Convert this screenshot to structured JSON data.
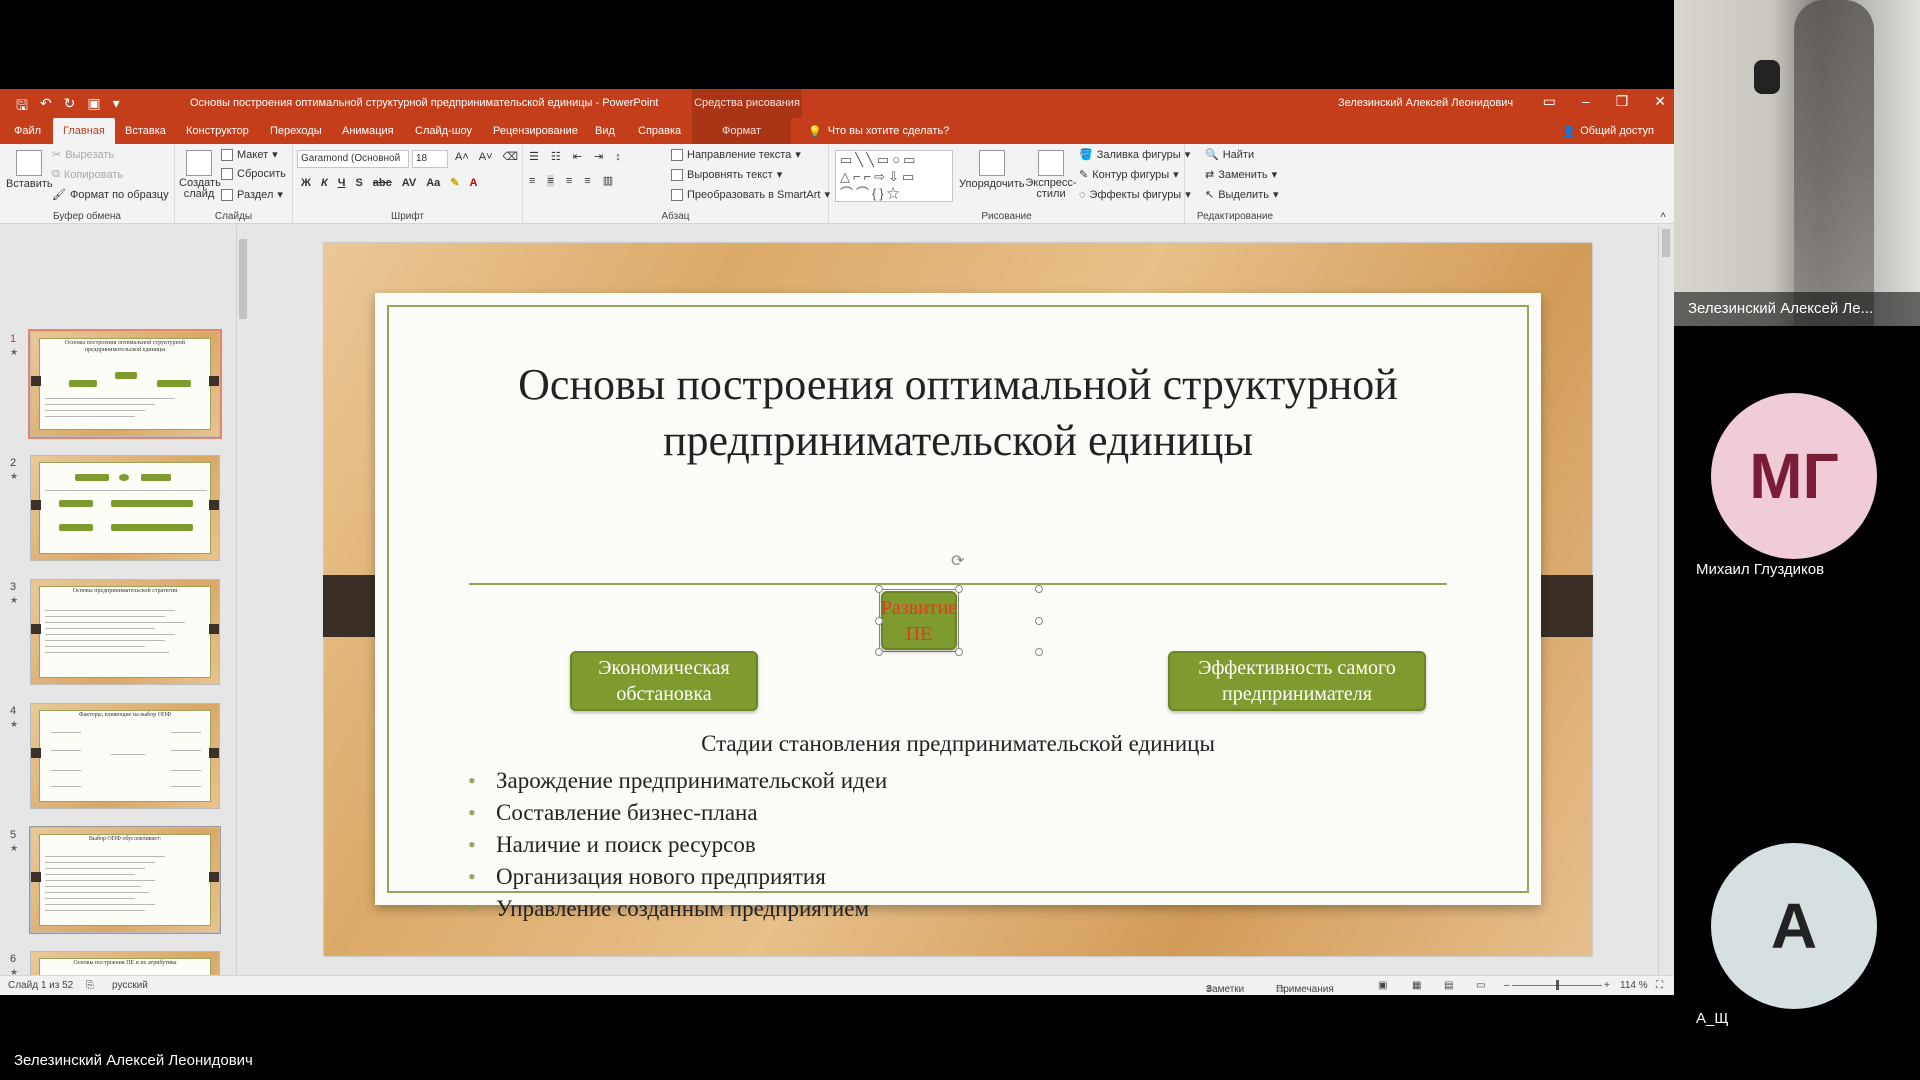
{
  "titlebar": {
    "doc_title": "Основы построения оптимальной структурной предпринимательской единицы  -  PowerPoint",
    "context_tools": "Средства рисования",
    "user": "Зелезинский Алексей Леонидович"
  },
  "tabs": [
    "Файл",
    "Главная",
    "Вставка",
    "Конструктор",
    "Переходы",
    "Анимация",
    "Слайд-шоу",
    "Рецензирование",
    "Вид",
    "Справка"
  ],
  "context_tab": "Формат",
  "tell_me": "Что вы хотите сделать?",
  "share": "Общий доступ",
  "ribbon": {
    "clipboard": {
      "label": "Буфер обмена",
      "paste": "Вставить",
      "cut": "Вырезать",
      "copy": "Копировать",
      "format_painter": "Формат по образцу"
    },
    "slides": {
      "label": "Слайды",
      "new_slide": "Создать слайд",
      "layout": "Макет",
      "reset": "Сбросить",
      "section": "Раздел"
    },
    "font": {
      "label": "Шрифт",
      "font_name": "Garamond (Основной",
      "font_size": "18"
    },
    "paragraph": {
      "label": "Абзац",
      "text_direction": "Направление текста",
      "align_text": "Выровнять текст",
      "smartart": "Преобразовать в SmartArt"
    },
    "drawing": {
      "label": "Рисование",
      "arrange": "Упорядочить",
      "quick_styles": "Экспресс-стили",
      "shape_fill": "Заливка фигуры",
      "shape_outline": "Контур фигуры",
      "shape_effects": "Эффекты фигуры"
    },
    "editing": {
      "label": "Редактирование",
      "find": "Найти",
      "replace": "Заменить",
      "select": "Выделить"
    }
  },
  "thumbnails": [
    {
      "num": "1",
      "title": "Основы построения оптимальной структурной предпринимательской единицы"
    },
    {
      "num": "2",
      "title": ""
    },
    {
      "num": "3",
      "title": "Основы предпринимательской стратегии"
    },
    {
      "num": "4",
      "title": "Факторы, влияющие на выбор ОПФ"
    },
    {
      "num": "5",
      "title": "Выбор ОПФ обусловливает:"
    },
    {
      "num": "6",
      "title": "Основы построения ПЕ и их атрибутика"
    }
  ],
  "slide": {
    "title_line1": "Основы построения оптимальной структурной",
    "title_line2": "предпринимательской единицы",
    "center_box": "Развитие ПЕ",
    "left_box": "Экономическая обстановка",
    "right_box": "Эффективность самого предпринимателя",
    "subtitle": "Стадии становления предпринимательской единицы",
    "bullets": [
      "Зарождение предпринимательской идеи",
      "Составление бизнес-плана",
      "Наличие  и поиск ресурсов",
      "Организация нового предприятия",
      "Управление созданным предприятием"
    ]
  },
  "statusbar": {
    "slide_of": "Слайд 1 из 52",
    "language": "русский",
    "notes": "Заметки",
    "comments": "Примечания",
    "zoom": "114 %"
  },
  "participants": {
    "video_name": "Зелезинский Алексей Ле...",
    "p2_initials": "МГ",
    "p2_name": "Михаил Глуздиков",
    "p3_initials": "А",
    "p3_name": "А_Щ",
    "presenter": "Зелезинский Алексей Леонидович"
  },
  "colors": {
    "accent": "#c43e1c",
    "green": "#7f9a2e",
    "center_text": "#e8381c"
  }
}
